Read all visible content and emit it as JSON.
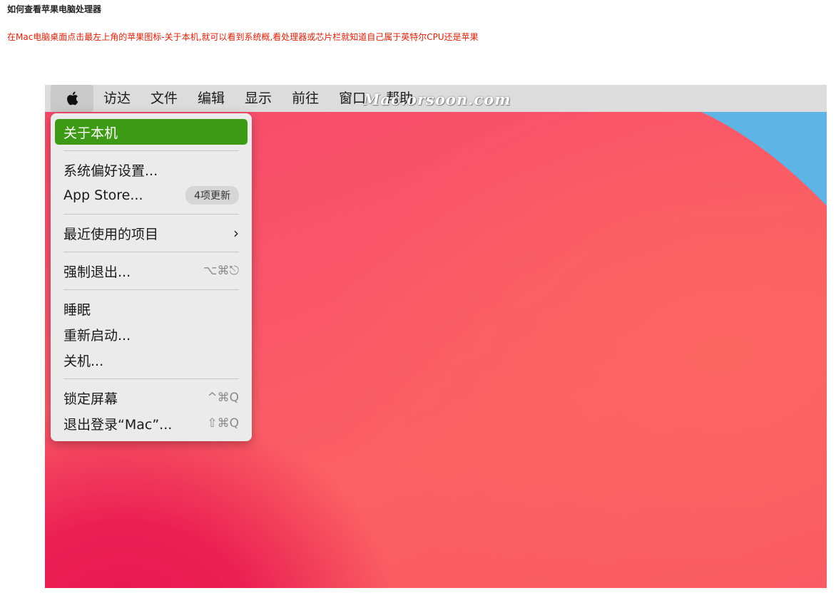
{
  "page": {
    "title": "如何查看苹果电脑处理器",
    "intro": "在Mac电脑桌面点击最左上角的苹果图标-关于本机,就可以看到系统概,看处理器或芯片栏就知道自己属于英特尔CPU还是苹果"
  },
  "screenshot": {
    "watermark": "Mac.orsoon.com",
    "menubar": {
      "apple_icon": "apple-logo-icon",
      "items": [
        "访达",
        "文件",
        "编辑",
        "显示",
        "前往",
        "窗口",
        "帮助"
      ]
    },
    "apple_menu": {
      "about": "关于本机",
      "system_prefs": "系统偏好设置...",
      "app_store": "App Store...",
      "app_store_badge": "4项更新",
      "recent_items": "最近使用的项目",
      "recent_chevron": "›",
      "force_quit": "强制退出...",
      "force_quit_shortcut": "⌥⌘⎋",
      "sleep": "睡眠",
      "restart": "重新启动...",
      "shutdown": "关机...",
      "lock_screen": "锁定屏幕",
      "lock_shortcut": "^⌘Q",
      "logout": "退出登录“Mac”...",
      "logout_shortcut": "⇧⌘Q"
    },
    "colors": {
      "highlight": "#3c9a14",
      "wallpaper_red": "#f6496a",
      "wallpaper_blue": "#5fb4e6"
    }
  }
}
